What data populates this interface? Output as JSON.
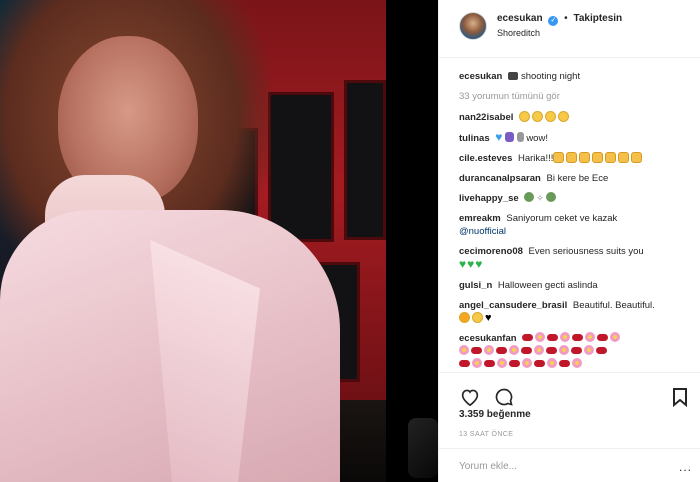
{
  "post": {
    "username": "ecesukan",
    "follow_status": "Takiptesin",
    "location": "Shoreditch",
    "caption_user": "ecesukan",
    "caption_text": "shooting night",
    "load_more": "33 yorumun tümünü gör",
    "likes": "3.359 beğenme",
    "time": "13 SAAT ÖNCE",
    "comment_placeholder": "Yorum ekle...",
    "more_label": "..."
  },
  "comments": [
    {
      "user": "nan22isabel",
      "text": ""
    },
    {
      "user": "tulinas",
      "text": "wow!"
    },
    {
      "user": "cile.esteves",
      "text": "Harika!!!"
    },
    {
      "user": "durancanalpsaran",
      "text": "Bi kere be Ece"
    },
    {
      "user": "livehappy_se",
      "text": ""
    },
    {
      "user": "emreakm",
      "text": "Saniyorum ceket ve kazak",
      "mention": "@nuofficial"
    },
    {
      "user": "cecimoreno08",
      "text": "Even seriousness suits you"
    },
    {
      "user": "gulsi_n",
      "text": "Halloween gecti aslinda"
    },
    {
      "user": "angel_cansudere_brasil",
      "text": "Beautiful. Beautiful."
    },
    {
      "user": "ecesukanfan",
      "text": ""
    }
  ],
  "icons": {
    "like": "heart-icon",
    "comment": "comment-icon",
    "save": "bookmark-icon",
    "verified": "verified-badge-icon"
  },
  "colors": {
    "verified": "#3897f0",
    "link": "#003569",
    "muted": "#999999"
  }
}
